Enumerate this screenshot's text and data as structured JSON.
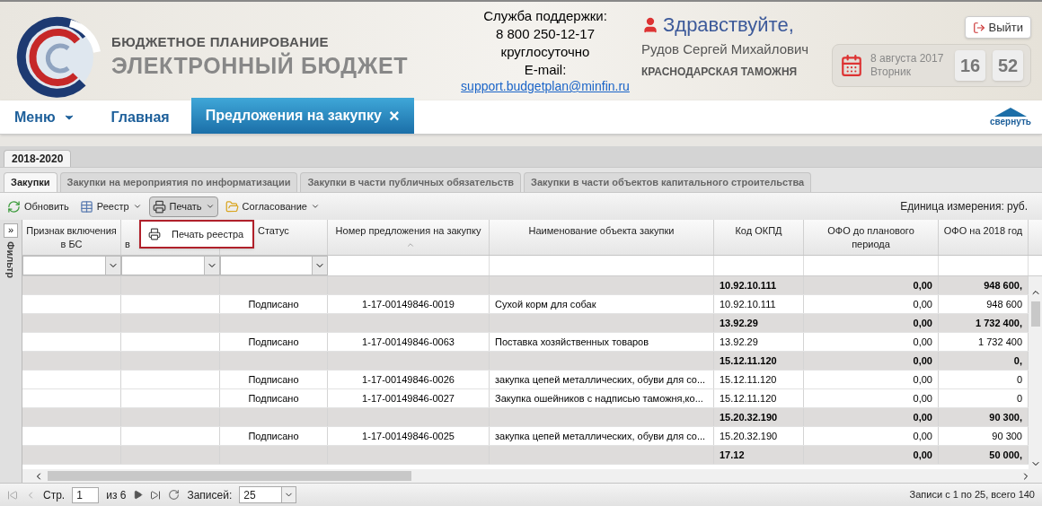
{
  "header": {
    "logo_line1": "БЮДЖЕТНОЕ ПЛАНИРОВАНИЕ",
    "logo_line2": "ЭЛЕКТРОННЫЙ БЮДЖЕТ",
    "support": [
      "Служба поддержки:",
      "8 800 250-12-17",
      "круглосуточно",
      "E-mail:"
    ],
    "support_email": "support.budgetplan@minfin.ru",
    "greeting": "Здравствуйте,",
    "user_name": "Рудов Сергей Михайлович",
    "organization": "КРАСНОДАРСКАЯ ТАМОЖНЯ",
    "logout": "Выйти",
    "date": "8 августа 2017",
    "weekday": "Вторник",
    "hours": "16",
    "minutes": "52"
  },
  "nav": {
    "items": [
      {
        "kind": "menu",
        "label": "Меню",
        "selected": false
      },
      {
        "kind": "link",
        "label": "Главная",
        "selected": false
      },
      {
        "kind": "tab",
        "label": "Предложения на закупку",
        "close": "×",
        "selected": true
      }
    ],
    "collapse": "свернуть"
  },
  "year_tabs": [
    {
      "label": "2018-2020",
      "selected": true
    }
  ],
  "sub_tabs": [
    {
      "label": "Закупки",
      "selected": true
    },
    {
      "label": "Закупки на мероприятия по информатизации",
      "selected": false
    },
    {
      "label": "Закупки в части публичных обязательств",
      "selected": false
    },
    {
      "label": "Закупки в части объектов капитального строительства",
      "selected": false
    }
  ],
  "toolbar": {
    "buttons": [
      {
        "kind": "refresh",
        "label": "Обновить",
        "dropdown": false,
        "selected": false
      },
      {
        "kind": "register",
        "label": "Реестр",
        "dropdown": true,
        "selected": false
      },
      {
        "kind": "print",
        "label": "Печать",
        "dropdown": true,
        "selected": true
      },
      {
        "kind": "approval",
        "label": "Согласование",
        "dropdown": true,
        "selected": false
      }
    ],
    "unit": "Единица измерения: руб."
  },
  "print_menu": {
    "items": [
      "Печать реестра"
    ]
  },
  "filter_panel": {
    "label": "Фильтр",
    "expand": "»"
  },
  "table": {
    "columns": [
      {
        "label": "Признак включения в БС",
        "kind": "select"
      },
      {
        "label": "в",
        "kind": "select"
      },
      {
        "label": "Статус",
        "kind": "select"
      },
      {
        "label": "Номер предложения на закупку",
        "kind": "text",
        "sorted": true
      },
      {
        "label": "Наименование объекта закупки",
        "kind": "text"
      },
      {
        "label": "Код ОКПД",
        "kind": "text"
      },
      {
        "label": "ОФО до планового периода",
        "kind": "text"
      },
      {
        "label": "ОФО на 2018 год",
        "kind": "text"
      }
    ],
    "rows": [
      {
        "kind": "group",
        "okpd": "10.92.10.111",
        "ofo_before": "0,00",
        "ofo_2018": "948 600,"
      },
      {
        "kind": "item",
        "status": "Подписано",
        "number": "1-17-00149846-0019",
        "name": "Сухой корм для собак",
        "okpd": "10.92.10.111",
        "ofo_before": "0,00",
        "ofo_2018": "948 600"
      },
      {
        "kind": "group",
        "okpd": "13.92.29",
        "ofo_before": "0,00",
        "ofo_2018": "1 732 400,"
      },
      {
        "kind": "item",
        "status": "Подписано",
        "number": "1-17-00149846-0063",
        "name": "Поставка хозяйственных товаров",
        "okpd": "13.92.29",
        "ofo_before": "0,00",
        "ofo_2018": "1 732 400"
      },
      {
        "kind": "group",
        "okpd": "15.12.11.120",
        "ofo_before": "0,00",
        "ofo_2018": "0,"
      },
      {
        "kind": "item",
        "status": "Подписано",
        "number": "1-17-00149846-0026",
        "name": "закупка цепей металлических, обуви для со...",
        "okpd": "15.12.11.120",
        "ofo_before": "0,00",
        "ofo_2018": "0"
      },
      {
        "kind": "item",
        "status": "Подписано",
        "number": "1-17-00149846-0027",
        "name": "Закупка ошейников с надписью таможня,ко...",
        "okpd": "15.12.11.120",
        "ofo_before": "0,00",
        "ofo_2018": "0"
      },
      {
        "kind": "group",
        "okpd": "15.20.32.190",
        "ofo_before": "0,00",
        "ofo_2018": "90 300,"
      },
      {
        "kind": "item",
        "status": "Подписано",
        "number": "1-17-00149846-0025",
        "name": "закупка цепей металлических, обуви для со...",
        "okpd": "15.20.32.190",
        "ofo_before": "0,00",
        "ofo_2018": "90 300"
      },
      {
        "kind": "group",
        "okpd": "17.12",
        "ofo_before": "0,00",
        "ofo_2018": "50 000,"
      }
    ]
  },
  "pager": {
    "page_label": "Стр.",
    "page": "1",
    "of": "из 6",
    "per_page_label": "Записей:",
    "per_page": "25",
    "summary": "Записи с 1 по 25, всего 140"
  }
}
